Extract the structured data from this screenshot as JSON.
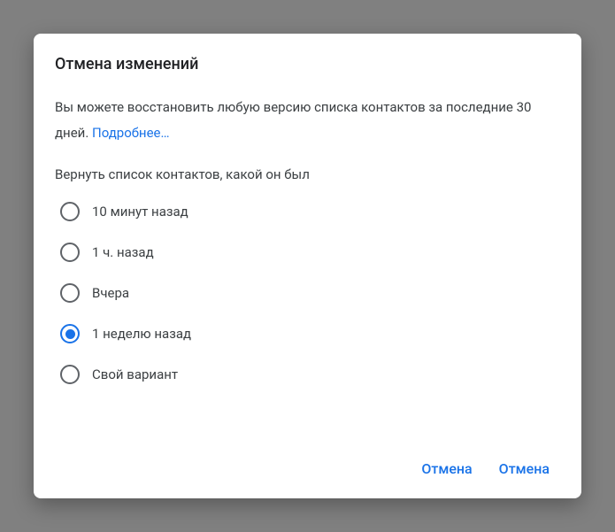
{
  "dialog": {
    "title": "Отмена изменений",
    "description_prefix": "Вы можете восстановить любую версию списка контактов за последние 30 дней. ",
    "learn_more": "Подробнее…",
    "restore_label": "Вернуть список контактов, какой он был",
    "options": [
      {
        "label": "10 минут назад",
        "selected": false
      },
      {
        "label": "1 ч. назад",
        "selected": false
      },
      {
        "label": "Вчера",
        "selected": false
      },
      {
        "label": "1 неделю назад",
        "selected": true
      },
      {
        "label": "Свой вариант",
        "selected": false
      }
    ],
    "actions": {
      "cancel": "Отмена",
      "confirm": "Отмена"
    }
  }
}
